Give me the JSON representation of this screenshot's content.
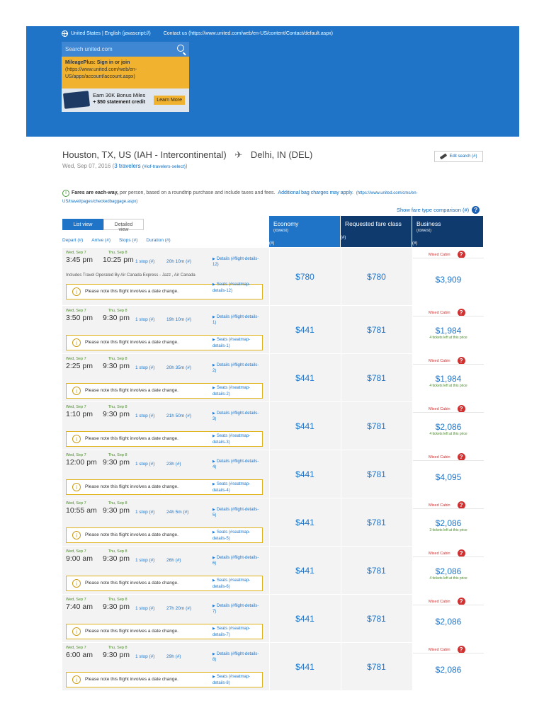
{
  "header": {
    "locale": "United States | English (javascript://)",
    "contact": "Contact us (https://www.united.com/web/en-US/content/Contact/default.aspx)",
    "search_placeholder": "Search united.com",
    "mileage_title": "MileagePlus: Sign in or join",
    "mileage_link": "(https://www.united.com/web/en-US/apps/account/account.aspx)",
    "promo_line1": "Earn 30K Bonus Miles",
    "promo_line2": "+ $50 statement credit",
    "promo_button": "Learn More"
  },
  "trip": {
    "origin": "Houston, TX, US (IAH - Intercontinental)",
    "destination": "Delhi, IN (DEL)",
    "date": "Wed, Sep 07, 2016 (",
    "travelers": "3 travelers",
    "travelers_link": "(#lof-travelers-select)",
    "close_paren": ")",
    "edit_search": "Edit search (#)"
  },
  "notice": {
    "bold": "Fares are each-way,",
    "text": " per person, based on a roundtrip purchase and include taxes and fees.",
    "bag_link": "Additional bag charges may apply.",
    "bag_url": "(https://www.united.com/cms/en-US/travel/pages/checkedbaggage.aspx)",
    "show_compare": "Show fare type comparison (#)"
  },
  "table": {
    "list_view": "List view",
    "detailed_view": "Detailed view",
    "sort": [
      "Depart (#)",
      "Arrive (#)",
      "Stops (#)",
      "Duration (#)"
    ],
    "economy": "Economy",
    "economy_sub": "(lowest)",
    "requested": "Requested fare class",
    "business": "Business",
    "business_sub": "(lowest)",
    "hash": "(#)",
    "mixed_cabin": "Mixed Cabin",
    "date_change": "Please note this flight involves a date change."
  },
  "flights": [
    {
      "dep_date": "Wed, Sep 7",
      "arr_date": "Thu, Sep 8",
      "dep": "3:45 pm",
      "arr": "10:25 pm",
      "stops": "1 stop (#)",
      "duration": "20h 10m (#)",
      "details": "Details (#flight-details-12)",
      "seats": "Seats (#seatmap-details-12)",
      "operated": "Includes Travel Operated By Air Canada Express - Jazz , Air Canada",
      "economy": "$780",
      "requested": "$780",
      "business": "$3,909",
      "tickets": ""
    },
    {
      "dep_date": "Wed, Sep 7",
      "arr_date": "Thu, Sep 8",
      "dep": "3:50 pm",
      "arr": "9:30 pm",
      "stops": "1 stop (#)",
      "duration": "19h 10m (#)",
      "details": "Details (#flight-details-1)",
      "seats": "Seats (#seatmap-details-1)",
      "operated": "",
      "economy": "$441",
      "requested": "$781",
      "business": "$1,984",
      "tickets": "4 tickets left at this price"
    },
    {
      "dep_date": "Wed, Sep 7",
      "arr_date": "Thu, Sep 8",
      "dep": "2:25 pm",
      "arr": "9:30 pm",
      "stops": "1 stop (#)",
      "duration": "20h 35m (#)",
      "details": "Details (#flight-details-2)",
      "seats": "Seats (#seatmap-details-2)",
      "operated": "",
      "economy": "$441",
      "requested": "$781",
      "business": "$1,984",
      "tickets": "4 tickets left at this price"
    },
    {
      "dep_date": "Wed, Sep 7",
      "arr_date": "Thu, Sep 8",
      "dep": "1:10 pm",
      "arr": "9:30 pm",
      "stops": "1 stop (#)",
      "duration": "21h 50m (#)",
      "details": "Details (#flight-details-3)",
      "seats": "Seats (#seatmap-details-3)",
      "operated": "",
      "economy": "$441",
      "requested": "$781",
      "business": "$2,086",
      "tickets": "4 tickets left at this price"
    },
    {
      "dep_date": "Wed, Sep 7",
      "arr_date": "Thu, Sep 8",
      "dep": "12:00 pm",
      "arr": "9:30 pm",
      "stops": "1 stop (#)",
      "duration": "23h (#)",
      "details": "Details (#flight-details-4)",
      "seats": "Seats (#seatmap-details-4)",
      "operated": "",
      "economy": "$441",
      "requested": "$781",
      "business": "$4,095",
      "tickets": ""
    },
    {
      "dep_date": "Wed, Sep 7",
      "arr_date": "Thu, Sep 8",
      "dep": "10:55 am",
      "arr": "9:30 pm",
      "stops": "1 stop (#)",
      "duration": "24h 5m (#)",
      "details": "Details (#flight-details-5)",
      "seats": "Seats (#seatmap-details-5)",
      "operated": "",
      "economy": "$441",
      "requested": "$781",
      "business": "$2,086",
      "tickets": "3 tickets left at this price"
    },
    {
      "dep_date": "Wed, Sep 7",
      "arr_date": "Thu, Sep 8",
      "dep": "9:00 am",
      "arr": "9:30 pm",
      "stops": "1 stop (#)",
      "duration": "26h (#)",
      "details": "Details (#flight-details-6)",
      "seats": "Seats (#seatmap-details-6)",
      "operated": "",
      "economy": "$441",
      "requested": "$781",
      "business": "$2,086",
      "tickets": "4 tickets left at this price"
    },
    {
      "dep_date": "Wed, Sep 7",
      "arr_date": "Thu, Sep 8",
      "dep": "7:40 am",
      "arr": "9:30 pm",
      "stops": "1 stop (#)",
      "duration": "27h 20m (#)",
      "details": "Details (#flight-details-7)",
      "seats": "Seats (#seatmap-details-7)",
      "operated": "",
      "economy": "$441",
      "requested": "$781",
      "business": "$2,086",
      "tickets": ""
    },
    {
      "dep_date": "Wed, Sep 7",
      "arr_date": "Thu, Sep 8",
      "dep": "6:00 am",
      "arr": "9:30 pm",
      "stops": "1 stop (#)",
      "duration": "29h (#)",
      "details": "Details (#flight-details-8)",
      "seats": "Seats (#seatmap-details-8)",
      "operated": "",
      "economy": "$441",
      "requested": "$781",
      "business": "$2,086",
      "tickets": ""
    }
  ],
  "colors": {
    "brand_blue": "#1f74c8",
    "navy": "#0e3a6e",
    "gold": "#f1b32f",
    "mixed_red": "#d03030",
    "date_green": "#4a8a2a"
  }
}
